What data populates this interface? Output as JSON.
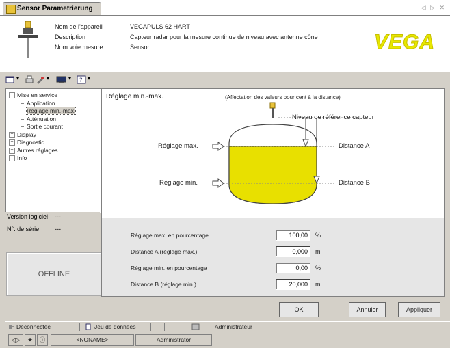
{
  "tab": {
    "title": "Sensor Parametrierung",
    "controls": "◁ ▷ ✕"
  },
  "header": {
    "labels": [
      "Nom de l'appareil",
      "Description",
      "Nom voie mesure"
    ],
    "values": [
      "VEGAPULS 62 HART",
      "Capteur radar pour la mesure continue de niveau avec antenne cône",
      "Sensor"
    ],
    "logo": "VEGA"
  },
  "tree": {
    "items": [
      {
        "label": "Mise en service",
        "level": 0,
        "expander": "−"
      },
      {
        "label": "Application",
        "level": 1
      },
      {
        "label": "Réglage min.-max.",
        "level": 1,
        "selected": true
      },
      {
        "label": "Atténuation",
        "level": 1
      },
      {
        "label": "Sortie courant",
        "level": 1
      },
      {
        "label": "Display",
        "level": 0,
        "expander": "+"
      },
      {
        "label": "Diagnostic",
        "level": 0,
        "expander": "+"
      },
      {
        "label": "Autres réglages",
        "level": 0,
        "expander": "+"
      },
      {
        "label": "Info",
        "level": 0,
        "expander": "+"
      }
    ]
  },
  "info": {
    "version_label": "Version logiciel",
    "version_value": "---",
    "serial_label": "N°. de série",
    "serial_value": "---",
    "status": "OFFLINE"
  },
  "diagram": {
    "title": "Réglage min.-max.",
    "subtitle": "(Affectation des valeurs pour cent à la distance)",
    "ref_label": "Niveau de référence capteur",
    "max_label": "Réglage max.",
    "min_label": "Réglage min.",
    "dist_a": "Distance A",
    "dist_b": "Distance B"
  },
  "form": {
    "rows": [
      {
        "label": "Réglage max. en pourcentage",
        "value": "100,00",
        "unit": "%"
      },
      {
        "label": "Distance A (réglage max.)",
        "value": "0,000",
        "unit": "m"
      },
      {
        "label": "Réglage min. en pourcentage",
        "value": "0,00",
        "unit": "%"
      },
      {
        "label": "Distance B (réglage min.)",
        "value": "20,000",
        "unit": "m"
      }
    ]
  },
  "buttons": {
    "ok": "OK",
    "cancel": "Annuler",
    "apply": "Appliquer"
  },
  "statusbar": {
    "connection": "Déconnectée",
    "dataset": "Jeu de données",
    "user": "Administrateur"
  },
  "bottombar": {
    "noname": "<NONAME>",
    "admin": "Administrator"
  },
  "colors": {
    "tank_fill": "#e8e000",
    "accent": "#e8e800"
  }
}
